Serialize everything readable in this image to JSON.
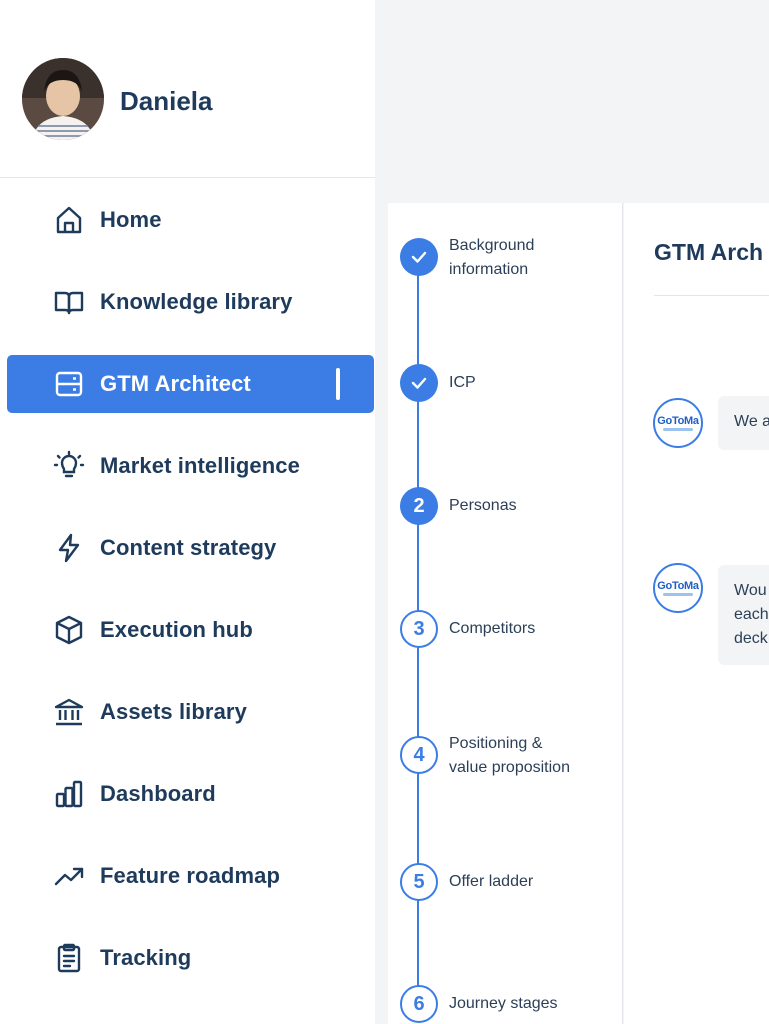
{
  "user": {
    "name": "Daniela"
  },
  "nav": {
    "items": [
      {
        "label": "Home",
        "icon": "home-icon"
      },
      {
        "label": "Knowledge library",
        "icon": "book-icon"
      },
      {
        "label": "GTM Architect",
        "icon": "server-icon",
        "active": true
      },
      {
        "label": "Market intelligence",
        "icon": "lightbulb-icon"
      },
      {
        "label": "Content strategy",
        "icon": "lightning-icon"
      },
      {
        "label": "Execution hub",
        "icon": "cube-icon"
      },
      {
        "label": "Assets library",
        "icon": "bank-icon"
      },
      {
        "label": "Dashboard",
        "icon": "bar-chart-icon"
      },
      {
        "label": "Feature roadmap",
        "icon": "trend-up-icon"
      },
      {
        "label": "Tracking",
        "icon": "clipboard-icon"
      }
    ]
  },
  "steps": [
    {
      "marker": "",
      "label_line1": "Background",
      "label_line2": "information",
      "status": "done"
    },
    {
      "marker": "",
      "label_line1": "ICP",
      "label_line2": "",
      "status": "done"
    },
    {
      "marker": "2",
      "label_line1": "Personas",
      "label_line2": "",
      "status": "current"
    },
    {
      "marker": "3",
      "label_line1": "Competitors",
      "label_line2": "",
      "status": "todo"
    },
    {
      "marker": "4",
      "label_line1": "Positioning &",
      "label_line2": "value proposition",
      "status": "todo"
    },
    {
      "marker": "5",
      "label_line1": "Offer ladder",
      "label_line2": "",
      "status": "todo"
    },
    {
      "marker": "6",
      "label_line1": "Journey stages",
      "label_line2": "",
      "status": "todo"
    }
  ],
  "main": {
    "title": "GTM Arch",
    "bot_logo": "GoToMa",
    "messages": [
      {
        "line1": "We a",
        "line2": "",
        "line3": ""
      },
      {
        "line1": "Wou",
        "line2": "each",
        "line3": "deck"
      }
    ]
  },
  "colors": {
    "accent": "#3b7de5",
    "text": "#1f3b5c",
    "background": "#f3f4f6"
  }
}
